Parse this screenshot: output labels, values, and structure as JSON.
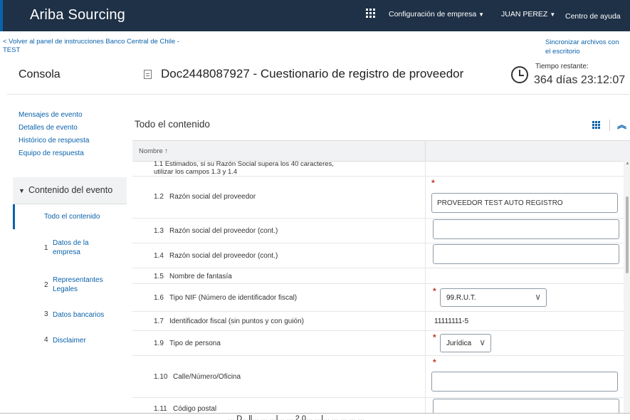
{
  "header": {
    "brand": "Ariba Sourcing",
    "apps_icon": "apps-grid-icon",
    "company_settings": "Configuración de empresa",
    "user": "JUAN PEREZ",
    "help": "Centro de ayuda"
  },
  "subheader": {
    "back_link": "< Volver al panel de instrucciones Banco Central de Chile - TEST",
    "sync_link": "Sincronizar archivos con el escritorio",
    "console": "Consola",
    "doc_title": "Doc2448087927 - Cuestionario de registro de proveedor",
    "time_label": "Tiempo restante:",
    "time_value": "364 días 23:12:07"
  },
  "sidebar": {
    "links": [
      "Mensajes de evento",
      "Detalles de evento",
      "Histórico de respuesta",
      "Equipo de respuesta"
    ],
    "section_title": "Contenido del evento",
    "items": [
      {
        "num": "",
        "label": "Todo el contenido"
      },
      {
        "num": "1",
        "label": "Datos de la empresa"
      },
      {
        "num": "2",
        "label": "Representantes Legales"
      },
      {
        "num": "3",
        "label": "Datos bancarios"
      },
      {
        "num": "4",
        "label": "Disclaimer"
      }
    ]
  },
  "main": {
    "title": "Todo el contenido",
    "column_name": "Nombre ↑",
    "partial_row": {
      "line1": "1.1   Estimados, si su Razón Social supera los 40 caracteres,",
      "line2": "utilizar los campos 1.3 y 1.4"
    },
    "rows": [
      {
        "num": "1.2",
        "label": "Razón social del proveedor",
        "value": "PROVEEDOR TEST AUTO REGISTRO",
        "required": "*"
      },
      {
        "num": "1.3",
        "label": "Razón social del proveedor (cont.)",
        "value": ""
      },
      {
        "num": "1.4",
        "label": "Razón social del proveedor (cont.)",
        "value": ""
      },
      {
        "num": "1.5",
        "label": "Nombre de fantasía"
      },
      {
        "num": "1.6",
        "label": "Tipo NIF (Número de identificador fiscal)",
        "value": "99.R.U.T.",
        "required": "*"
      },
      {
        "num": "1.7",
        "label": "Identificador fiscal (sin puntos y con guión)",
        "value": "11111111-5"
      },
      {
        "num": "1.9",
        "label": "Tipo de persona",
        "value": "Jurídica",
        "required": "*"
      },
      {
        "num": "1.10",
        "label": "Calle/Número/Oficina",
        "value": "",
        "required": "*"
      },
      {
        "num": "1.11",
        "label": "Código postal",
        "value": ""
      }
    ]
  },
  "footer_partial_text": "...  D...ll...  ...  ...l...  ...  2.0...  ...l...  ...  ...  ...  ..."
}
